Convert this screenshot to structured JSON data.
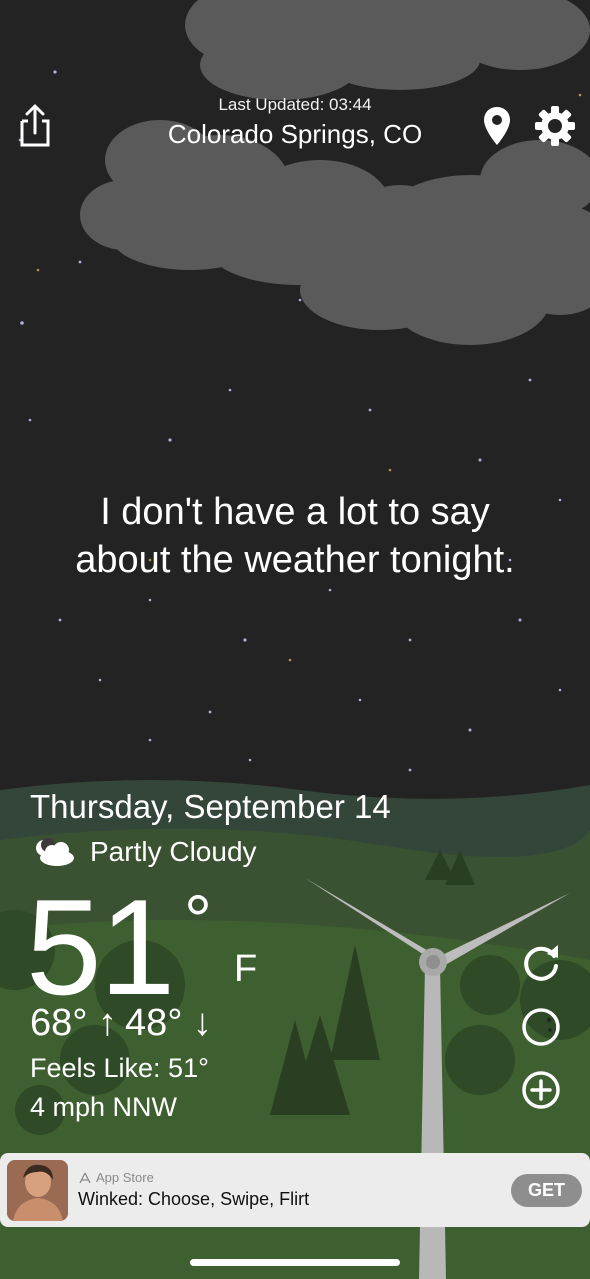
{
  "header": {
    "last_updated": "Last Updated: 03:44",
    "location": "Colorado Springs, CO"
  },
  "message": {
    "line1": "I don't have a lot to say",
    "line2": "about the weather tonight."
  },
  "weather": {
    "date": "Thursday, September 14",
    "condition": "Partly Cloudy",
    "temperature": "51",
    "degree_symbol": "°",
    "unit": "F",
    "high": "68° ↑",
    "low": "48° ↓",
    "feels_like": "Feels Like: 51°",
    "wind": "4 mph NNW"
  },
  "icons": {
    "share": "share-icon",
    "location": "location-pin-icon",
    "settings": "gear-icon",
    "condition": "partly-cloudy-night-icon",
    "refresh": "refresh-icon",
    "moon": "moon-phase-icon",
    "add": "add-icon"
  },
  "ad": {
    "store_label": "App Store",
    "title": "Winked: Choose, Swipe, Flirt",
    "button": "GET"
  },
  "colors": {
    "sky": "#232323",
    "cloud": "#565656",
    "hill_far": "#3a4a3a",
    "grass": "#3b5a2e",
    "ad_bg": "#ececec",
    "get_button": "#8e8e8e"
  }
}
